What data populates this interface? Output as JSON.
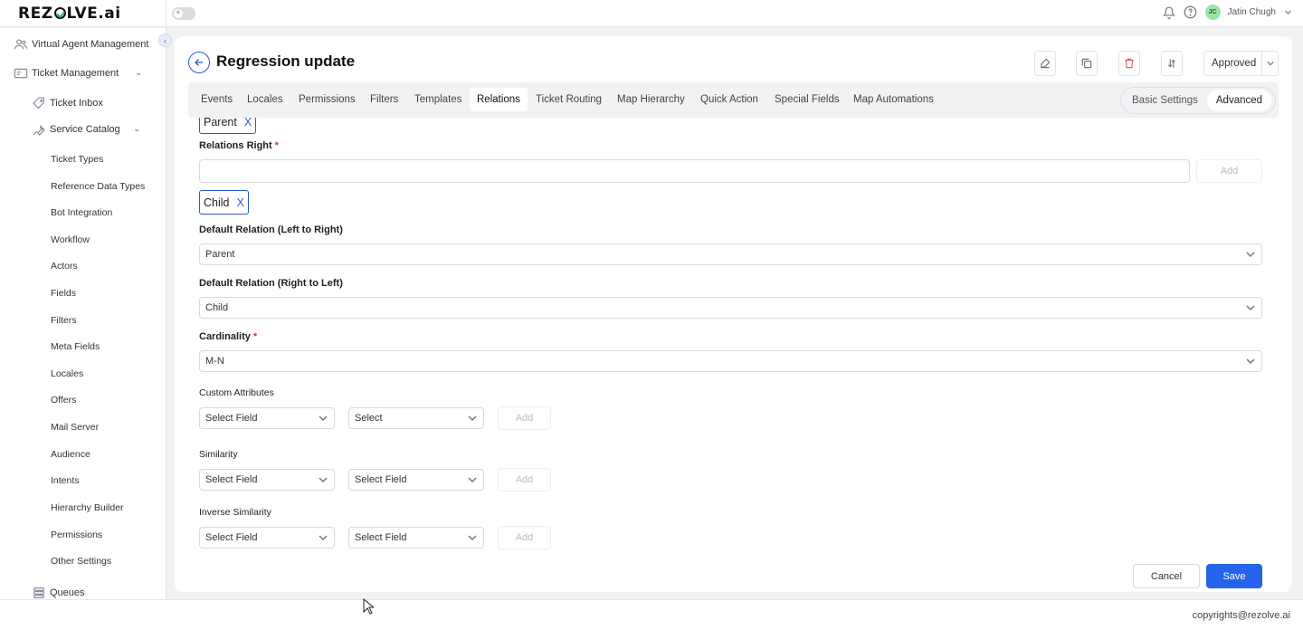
{
  "app": {
    "logo_text_left": "REZ",
    "logo_text_right": "LVE.ai"
  },
  "user": {
    "initials": "JC",
    "name": "Jatin Chugh"
  },
  "sidebar": {
    "main_items": [
      {
        "label": "Virtual Agent Management"
      },
      {
        "label": "Ticket Management"
      },
      {
        "label": "Ticket Inbox"
      },
      {
        "label": "Service Catalog"
      },
      {
        "label": "Queues"
      }
    ],
    "sub_items": [
      "Ticket Types",
      "Reference Data Types",
      "Bot Integration",
      "Workflow",
      "Actors",
      "Fields",
      "Filters",
      "Meta Fields",
      "Locales",
      "Offers",
      "Mail Server",
      "Audience",
      "Intents",
      "Hierarchy Builder",
      "Permissions",
      "Other Settings"
    ]
  },
  "header": {
    "title": "Regression update",
    "status": "Approved"
  },
  "tabs": [
    "Events",
    "Locales",
    "Permissions",
    "Filters",
    "Templates",
    "Relations",
    "Ticket Routing",
    "Map Hierarchy",
    "Quick Action",
    "Special Fields",
    "Map Automations"
  ],
  "active_tab": "Relations",
  "mode": {
    "basic": "Basic Settings",
    "advanced": "Advanced",
    "active": "Advanced"
  },
  "form": {
    "chip_left": "Parent",
    "chip_remove": "X",
    "relations_right_label": "Relations Right",
    "required_mark": "*",
    "relations_right_value": "",
    "add_label": "Add",
    "chip_right": "Child",
    "default_lr_label": "Default Relation (Left to Right)",
    "default_lr_value": "Parent",
    "default_rl_label": "Default Relation (Right to Left)",
    "default_rl_value": "Child",
    "cardinality_label": "Cardinality",
    "cardinality_value": "M-N",
    "custom_attributes_label": "Custom Attributes",
    "custom_attr_field": "Select Field",
    "custom_attr_value": "Select",
    "similarity_label": "Similarity",
    "similarity_left": "Select Field",
    "similarity_right": "Select Field",
    "inverse_similarity_label": "Inverse Similarity",
    "inverse_left": "Select Field",
    "inverse_right": "Select Field"
  },
  "actions": {
    "cancel": "Cancel",
    "save": "Save"
  },
  "footer": {
    "copyright": "copyrights@rezolve.ai"
  },
  "colors": {
    "primary": "#2563eb",
    "brand_green": "#2bb673",
    "danger": "#e05252"
  }
}
